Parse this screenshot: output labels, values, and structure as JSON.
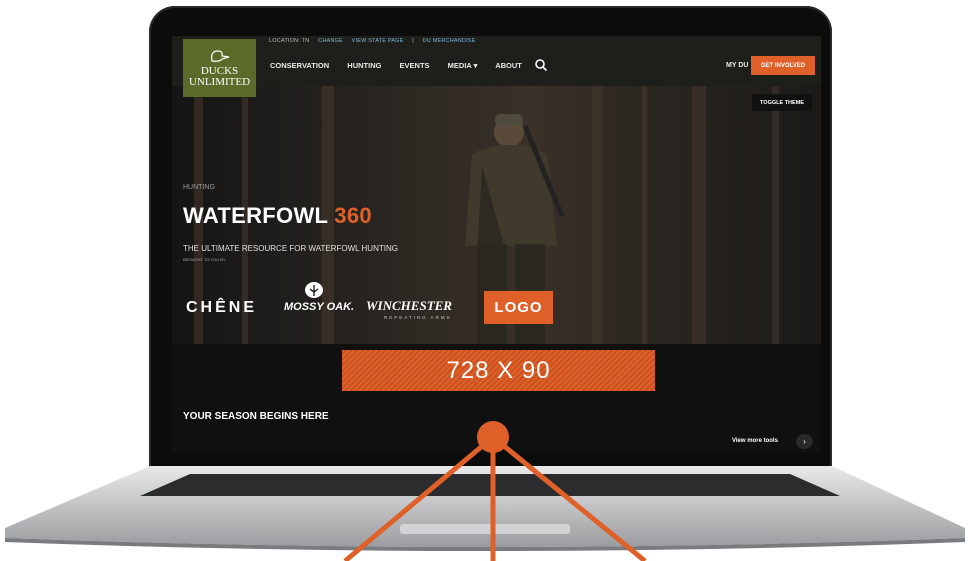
{
  "logo": {
    "line1": "DUCKS",
    "line2": "UNLIMITED"
  },
  "utility_bar": {
    "location": "LOCATION: TN",
    "change": "CHANGE",
    "state_page": "VIEW STATE PAGE",
    "separator": "|",
    "merch": "DU MERCHANDISE"
  },
  "nav": {
    "items": [
      "CONSERVATION",
      "HUNTING",
      "EVENTS",
      "MEDIA ▾",
      "ABOUT"
    ],
    "my_du": "MY DU",
    "get_involved": "GET INVOLVED",
    "toggle_theme": "TOGGLE THEME"
  },
  "hero": {
    "eyebrow": "HUNTING",
    "title_main": "WATERFOWL ",
    "title_accent": "360",
    "subtitle": "THE ULTIMATE RESOURCE FOR WATERFOWL HUNTING",
    "brought_by": "BROUGHT TO YOU BY",
    "sponsors": {
      "chene": "CHÊNE",
      "mossy": "MOSSY OAK.",
      "winchester": "WINCHESTER",
      "winchester_sub": "REPEATING ARMS",
      "logo": "LOGO"
    }
  },
  "ad": {
    "label": "728 X 90"
  },
  "section": {
    "heading": "YOUR SEASON BEGINS HERE",
    "view_more": "View more tools",
    "chevron": "›"
  },
  "colors": {
    "accent": "#e0602a",
    "logo_green": "#5b6b2a",
    "nav_bg": "#1e1e1b"
  }
}
